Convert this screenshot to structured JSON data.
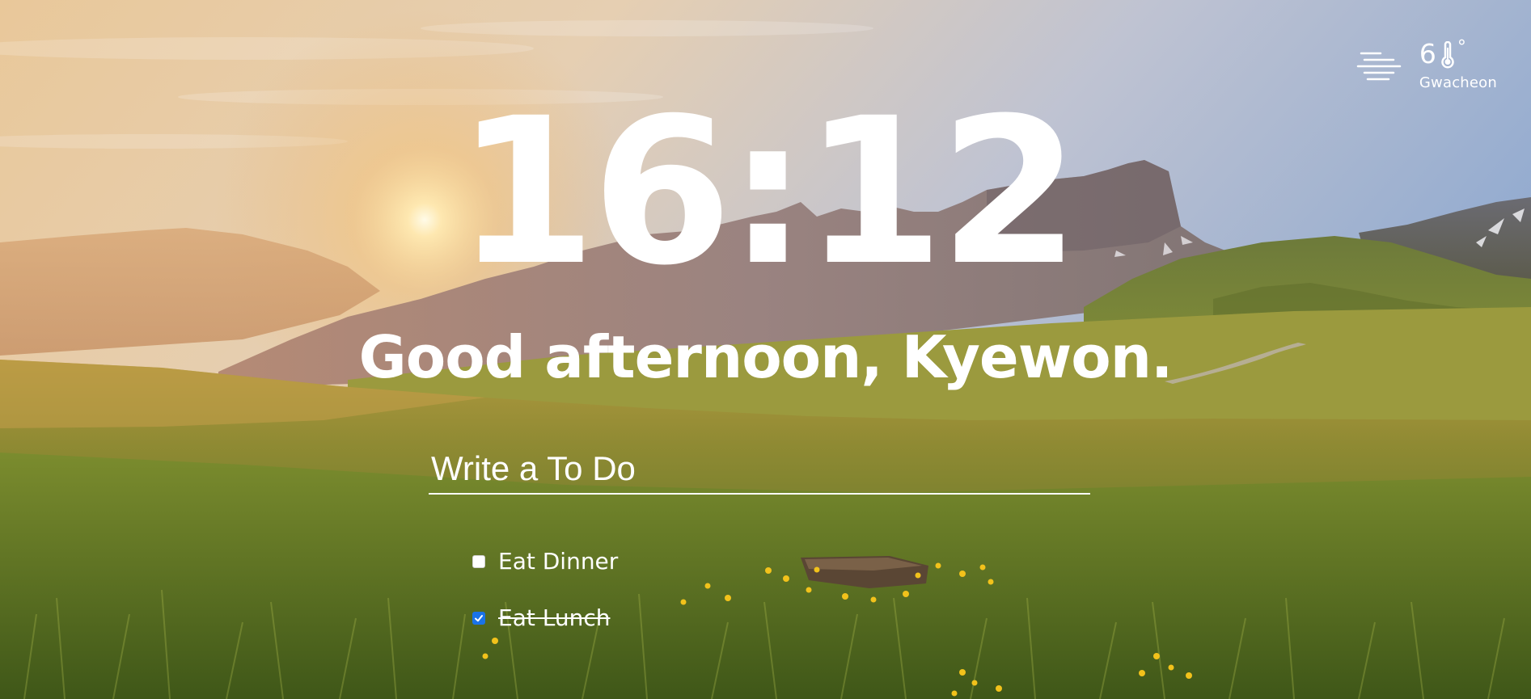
{
  "weather": {
    "icon": "fog-icon",
    "temperature": "6",
    "unit_icon": "thermometer-icon",
    "degree_symbol": "°",
    "city": "Gwacheon"
  },
  "clock": {
    "time": "16:12"
  },
  "greeting": {
    "text": "Good afternoon, Kyewon."
  },
  "todo": {
    "placeholder": "Write a To Do",
    "items": [
      {
        "label": "Eat Dinner",
        "done": false
      },
      {
        "label": "Eat Lunch",
        "done": true
      }
    ]
  },
  "colors": {
    "text": "#ffffff",
    "checkbox_checked": "#1a73e8",
    "sky_top": "#9fb6d6",
    "sun_glow": "#f6c87a",
    "grass": "#6f8a2c"
  }
}
